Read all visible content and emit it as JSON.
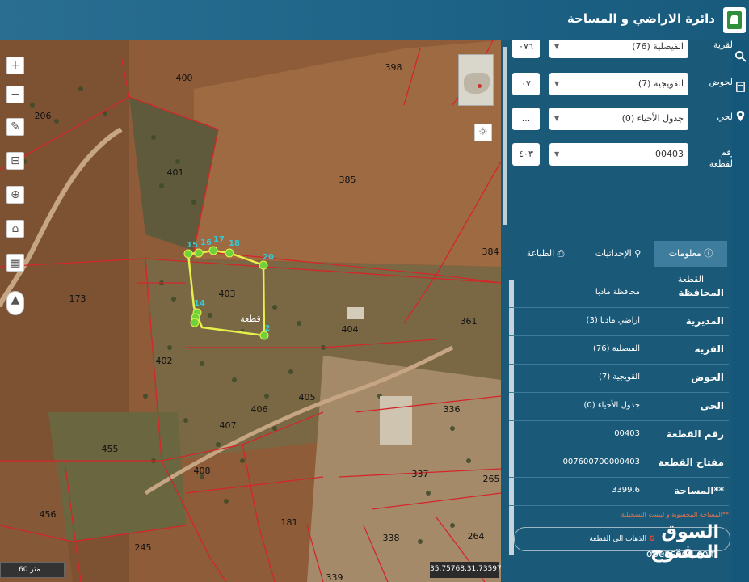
{
  "header": {
    "title": "دائرة الاراضي و المساحة"
  },
  "map": {
    "parcel_labels": [
      {
        "id": "p400",
        "text": "400"
      },
      {
        "id": "p398",
        "text": "398"
      },
      {
        "id": "p206",
        "text": "206"
      },
      {
        "id": "p401",
        "text": "401"
      },
      {
        "id": "p385",
        "text": "385"
      },
      {
        "id": "p384",
        "text": "384"
      },
      {
        "id": "p403",
        "text": "403"
      },
      {
        "id": "p173",
        "text": "173"
      },
      {
        "id": "p404",
        "text": "404"
      },
      {
        "id": "p361",
        "text": "361"
      },
      {
        "id": "p402",
        "text": "402"
      },
      {
        "id": "p405",
        "text": "405"
      },
      {
        "id": "p406",
        "text": "406"
      },
      {
        "id": "p407",
        "text": "407"
      },
      {
        "id": "p336",
        "text": "336"
      },
      {
        "id": "p455",
        "text": "455"
      },
      {
        "id": "p408",
        "text": "408"
      },
      {
        "id": "p337",
        "text": "337"
      },
      {
        "id": "p265",
        "text": "265"
      },
      {
        "id": "p456",
        "text": "456"
      },
      {
        "id": "p181",
        "text": "181"
      },
      {
        "id": "p245",
        "text": "245"
      },
      {
        "id": "p338",
        "text": "338"
      },
      {
        "id": "p264",
        "text": "264"
      },
      {
        "id": "p339",
        "text": "339"
      }
    ],
    "vertex_labels": [
      "15",
      "16",
      "17",
      "18",
      "20",
      "14",
      "2"
    ],
    "parcel_tag": "قطعة",
    "scale": "60 متر",
    "coords": "35.75768,31.73597",
    "tools": [
      "zoom-in",
      "zoom-out",
      "draw",
      "measure",
      "locate",
      "home",
      "print",
      "compass"
    ]
  },
  "panel": {
    "filters": [
      {
        "label": "القرية",
        "value": "الفيصلية (76)",
        "code": "٠٧٦"
      },
      {
        "label": "الحوض",
        "value": "القويجية (7)",
        "code": "٠٧"
      },
      {
        "label": "الحي",
        "value": "جدول الأحياء (0)",
        "code": "..."
      },
      {
        "label": "رقم القطعة",
        "value": "00403",
        "code": "٤٠٣"
      }
    ],
    "tabs": [
      {
        "label": "معلومات القطعة",
        "active": true
      },
      {
        "label": "الإحداثيات",
        "active": false
      },
      {
        "label": "الطباعة",
        "active": false
      }
    ],
    "info": [
      {
        "key": "المحافظة",
        "value": "محافظة مادبا"
      },
      {
        "key": "المديرية",
        "value": "اراضي مادبا (3)"
      },
      {
        "key": "القرية",
        "value": "الفيصلية (76)"
      },
      {
        "key": "الحوض",
        "value": "القويجية (7)"
      },
      {
        "key": "الحي",
        "value": "جدول الأحياء (0)"
      },
      {
        "key": "رقم القطعة",
        "value": "00403"
      },
      {
        "key": "مفتاح القطعة",
        "value": "007600700000403"
      },
      {
        "key": "**المساحة",
        "value": "3399.6"
      }
    ],
    "note": "**المساحة المحسوبة و ليست التسجيلية",
    "google_button": "الذهاب الى القطعة"
  },
  "watermark": {
    "arabic": "السوق المفتوح",
    "english": "opensooq.com"
  },
  "colors": {
    "header": "#1d6488",
    "panel": "#1a5a78",
    "parcel_line": "#d4262a",
    "selected": "#e7f04a"
  }
}
